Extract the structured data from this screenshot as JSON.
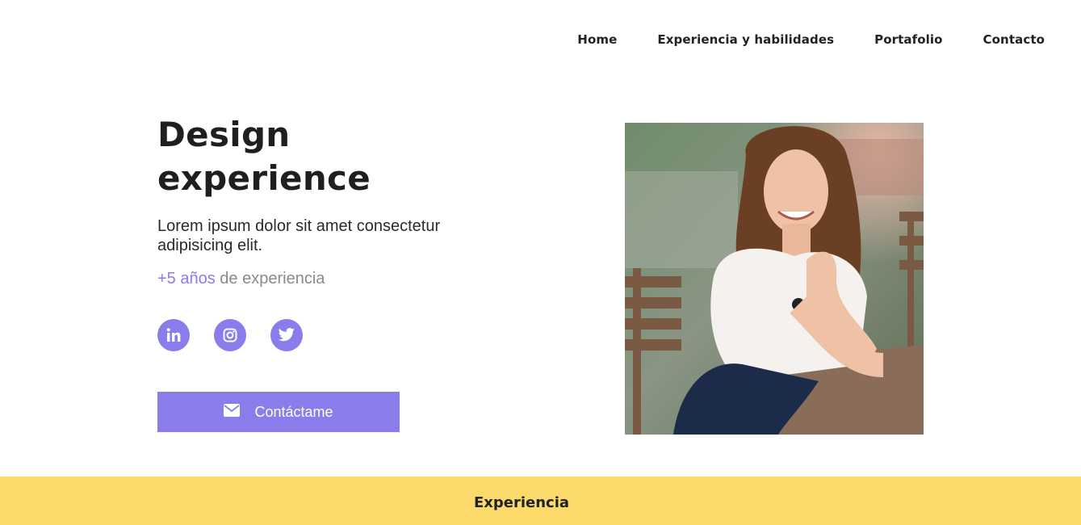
{
  "nav": {
    "items": [
      {
        "label": "Home"
      },
      {
        "label": "Experiencia y habilidades"
      },
      {
        "label": "Portafolio"
      },
      {
        "label": "Contacto"
      }
    ]
  },
  "hero": {
    "title_line1": "Design",
    "title_line2": "experience",
    "description": "Lorem ipsum dolor sit amet consectetur adipisicing elit.",
    "experience_highlight": "+5 años",
    "experience_rest": " de experiencia",
    "socials": [
      {
        "icon": "linkedin-icon"
      },
      {
        "icon": "instagram-icon"
      },
      {
        "icon": "twitter-icon"
      }
    ],
    "contact_button": {
      "label": "Contáctame",
      "icon": "envelope-icon"
    }
  },
  "section": {
    "title": "Experiencia"
  },
  "colors": {
    "accent": "#8b7cec",
    "band": "#fbda6b",
    "text": "#222222",
    "muted": "#8a8a8a"
  }
}
